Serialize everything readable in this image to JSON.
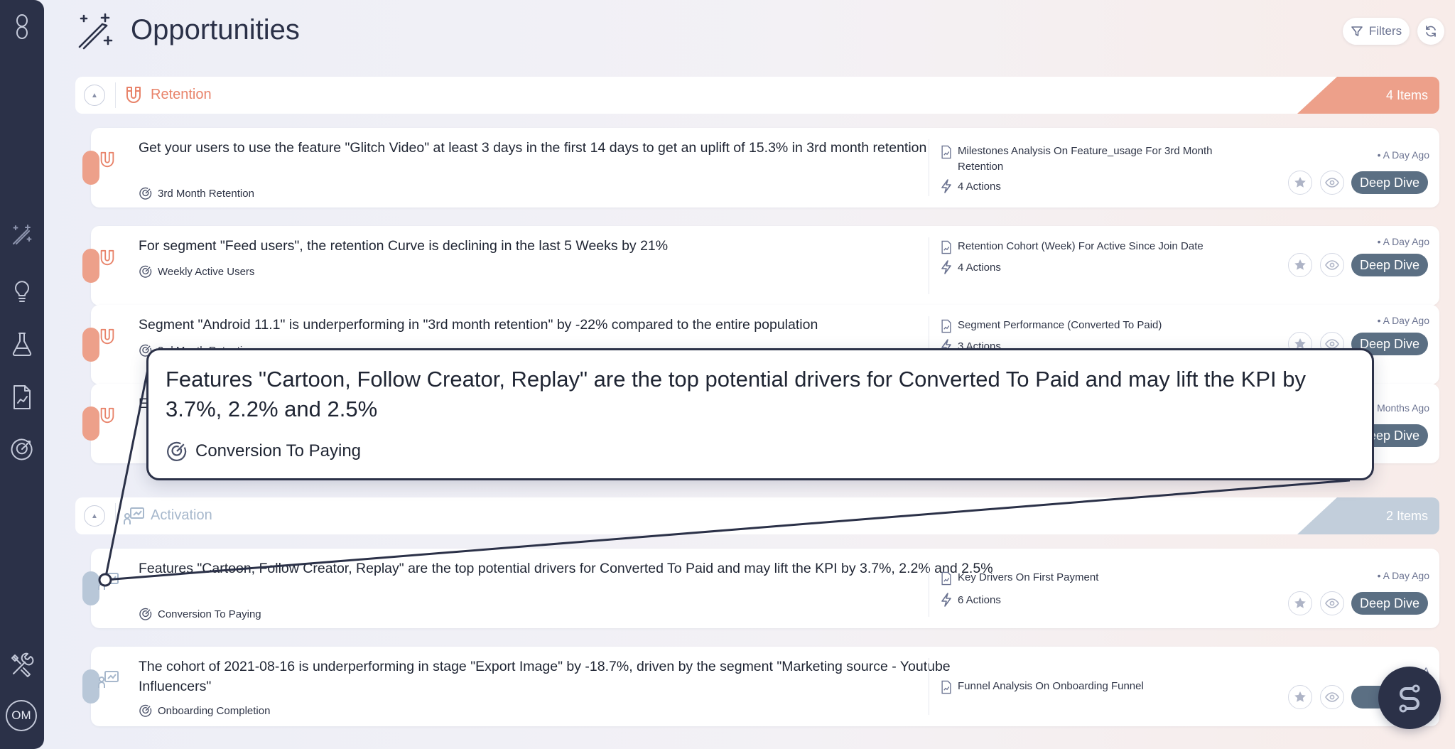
{
  "app": {
    "avatar_initials": "OM",
    "bot_icon": "s-logo-icon"
  },
  "header": {
    "title": "Opportunities",
    "filters_label": "Filters"
  },
  "sidebar": {
    "items": [
      {
        "icon": "logo-icon"
      },
      {
        "icon": "magic-wand-icon",
        "active": true
      },
      {
        "icon": "lightbulb-icon"
      },
      {
        "icon": "flask-icon"
      },
      {
        "icon": "report-icon"
      },
      {
        "icon": "target-icon"
      },
      {
        "icon": "tools-icon"
      }
    ]
  },
  "sections": [
    {
      "title": "Retention",
      "count": "4 Items",
      "color": "#e8836a",
      "count_bg": "#eda08a",
      "cards": [
        {
          "text": "Get your users to use the feature \"Glitch Video\" at least 3 days in the first 14 days to get an uplift of 15.3% in 3rd month retention",
          "kpi": "3rd Month Retention",
          "source": "Milestones Analysis On Feature_usage For 3rd Month Retention",
          "actions": "4 Actions",
          "time": "• A Day Ago",
          "button": "Deep Dive"
        },
        {
          "text": "For segment \"Feed users\", the retention Curve is declining in the last 5 Weeks by 21%",
          "kpi": "Weekly Active Users",
          "source": "Retention Cohort (Week) For Active Since Join Date",
          "actions": "4 Actions",
          "time": "• A Day Ago",
          "button": "Deep Dive"
        },
        {
          "text": "Segment \"Android 11.1\" is underperforming in \"3rd month retention\" by -22% compared to the entire population",
          "kpi": "3rd Month Retention",
          "source": "Segment Performance (Converted To Paid)",
          "actions": "3 Actions",
          "time": "• A Day Ago",
          "button": "Deep Dive"
        },
        {
          "text": "E",
          "kpi": "",
          "source": "",
          "actions": "",
          "time": "Months Ago",
          "button": "Deep Dive"
        }
      ]
    },
    {
      "title": "Activation",
      "count": "2 Items",
      "color": "#a7b8cc",
      "count_bg": "#c2cedb",
      "cards": [
        {
          "text": "Features \"Cartoon, Follow Creator, Replay\" are the top potential drivers for Converted To Paid and may lift the KPI by 3.7%, 2.2% and 2.5%",
          "kpi": "Conversion To Paying",
          "source": "Key Drivers On First Payment",
          "actions": "6 Actions",
          "time": "• A Day Ago",
          "button": "Deep Dive"
        },
        {
          "text": "The cohort of 2021-08-16 is underperforming in stage \"Export Image\" by -18.7%, driven by the segment \"Marketing source -  Youtube Influencers\"",
          "kpi": "Onboarding Completion",
          "source": "Funnel Analysis On Onboarding Funnel",
          "actions": "",
          "time": "• A",
          "button": "De"
        }
      ]
    }
  ],
  "callout": {
    "text": "Features \"Cartoon, Follow Creator, Replay\" are the top potential drivers for Converted To Paid and may lift the KPI by 3.7%, 2.2% and 2.5%",
    "kpi": "Conversion To Paying"
  }
}
